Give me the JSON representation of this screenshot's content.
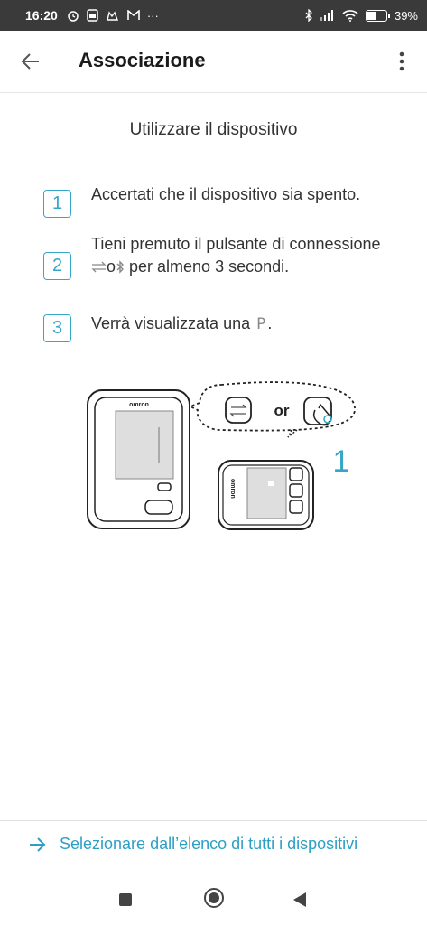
{
  "status_bar": {
    "time": "16:20",
    "left_icons": [
      "alarm-icon",
      "sim-icon",
      "cat-icon",
      "gmail-icon",
      "more-icon"
    ],
    "more_label": "···",
    "right_icons": [
      "bluetooth-icon",
      "signal-icon",
      "wifi-icon",
      "battery-icon"
    ],
    "battery_percent": "39",
    "battery_label": "39%",
    "battery_level": 0.39
  },
  "app_bar": {
    "title": "Associazione",
    "back_icon": "arrow-left-icon",
    "menu_icon": "more-vert-icon"
  },
  "main": {
    "subtitle": "Utilizzare il dispositivo",
    "steps": [
      {
        "number": "1",
        "text": "Accertati che il dispositivo sia spento."
      },
      {
        "number": "2",
        "text_before": "Tieni premuto il pulsante di connessione ",
        "text_o": "o",
        "text_after": " per almeno 3 secondi.",
        "icons": [
          "transfer-icon",
          "bluetooth-icon"
        ]
      },
      {
        "number": "3",
        "text_before": "Verrà visualizzata una ",
        "symbol": "P",
        "text_after": "."
      }
    ],
    "illustration": {
      "brand_label": "omron",
      "or_label": "or",
      "step_label": "1",
      "accent_color": "#35a6c9"
    }
  },
  "footer": {
    "link_label": "Selezionare dall’elenco di tutti i dispositivi",
    "link_icon": "arrow-right-icon",
    "link_color": "#2e9fc4"
  },
  "nav_bar": {
    "buttons": [
      "recents-button",
      "home-button",
      "back-button"
    ]
  }
}
